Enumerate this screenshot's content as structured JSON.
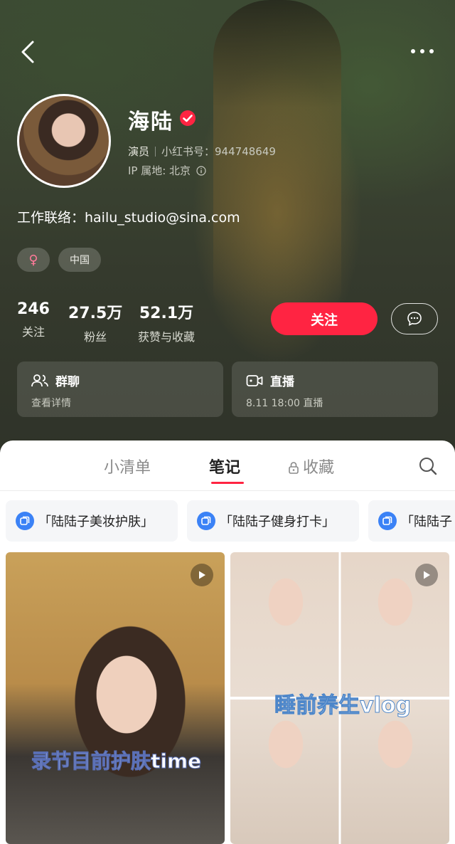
{
  "profile": {
    "name": "海陆",
    "role": "演员",
    "redbook_id": "小红书号：944748649",
    "ip": "IP 属地: 北京",
    "contact": "工作联络：hailu_studio@sina.com",
    "tags": {
      "gender": "♀",
      "region": "中国"
    }
  },
  "stats": [
    {
      "num": "246",
      "label": "关注"
    },
    {
      "num": "27.5万",
      "label": "粉丝"
    },
    {
      "num": "52.1万",
      "label": "获赞与收藏"
    }
  ],
  "actions": {
    "follow": "关注"
  },
  "cards": {
    "group": {
      "title": "群聊",
      "sub": "查看详情"
    },
    "live": {
      "title": "直播",
      "sub": "8.11 18:00 直播"
    }
  },
  "tabs": {
    "list": "小清单",
    "notes": "笔记",
    "saved": "收藏"
  },
  "collections": [
    "「陆陆子美妆护肤」",
    "「陆陆子健身打卡」",
    "「陆陆子"
  ],
  "notes": [
    {
      "overlay": "录节目前护肤time"
    },
    {
      "overlay": "睡前养生vlog"
    }
  ],
  "colors": {
    "accent": "#ff2442",
    "collection_icon": "#3b82f6"
  }
}
